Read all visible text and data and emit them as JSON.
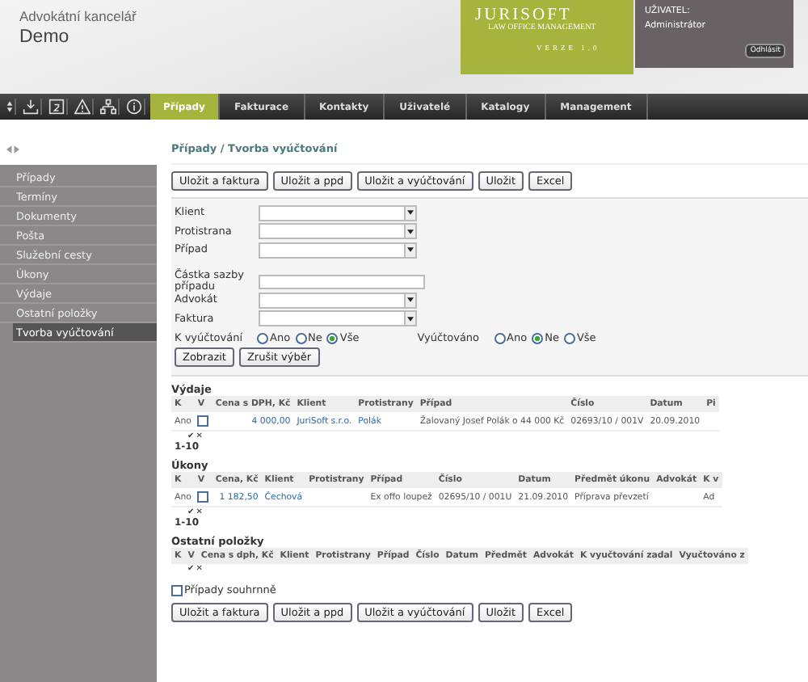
{
  "header": {
    "office_label": "Advokátní kancelář",
    "office_name": "Demo",
    "brand": {
      "name": "JURISOFT",
      "subtitle": "LAW OFFICE MANAGEMENT",
      "version": "VERZE 1.0"
    },
    "user": {
      "label": "UŽIVATEL:",
      "name": "Administrátor",
      "logout": "Odhlásit"
    }
  },
  "tabs": [
    {
      "label": "Případy",
      "selected": true
    },
    {
      "label": "Fakturace",
      "selected": false
    },
    {
      "label": "Kontakty",
      "selected": false
    },
    {
      "label": "Uživatelé",
      "selected": false
    },
    {
      "label": "Katalogy",
      "selected": false
    },
    {
      "label": "Management",
      "selected": false
    }
  ],
  "sidebar": {
    "items": [
      {
        "label": "Případy",
        "selected": false
      },
      {
        "label": "Termíny",
        "selected": false
      },
      {
        "label": "Dokumenty",
        "selected": false
      },
      {
        "label": "Pošta",
        "selected": false
      },
      {
        "label": "Služební cesty",
        "selected": false
      },
      {
        "label": "Úkony",
        "selected": false
      },
      {
        "label": "Výdaje",
        "selected": false
      },
      {
        "label": "Ostatní položky",
        "selected": false
      },
      {
        "label": "Tvorba vyúčtování",
        "selected": true
      }
    ]
  },
  "breadcrumb": "Případy / Tvorba vyúčtování",
  "top_buttons": [
    "Uložit a faktura",
    "Uložit a ppd",
    "Uložit a vyúčtování",
    "Uložit",
    "Excel"
  ],
  "filter": {
    "fields": [
      {
        "kind": "select",
        "label": "Klient"
      },
      {
        "kind": "select",
        "label": "Protistrana"
      },
      {
        "kind": "select",
        "label": "Případ"
      },
      {
        "kind": "gap"
      },
      {
        "kind": "text",
        "label": "Částka sazby případu"
      },
      {
        "kind": "select",
        "label": "Advokát"
      },
      {
        "kind": "select",
        "label": "Faktura"
      }
    ],
    "radio_groups": [
      {
        "label": "K vyúčtování",
        "options": [
          {
            "label": "Ano",
            "selected": false
          },
          {
            "label": "Ne",
            "selected": false
          },
          {
            "label": "Vše",
            "selected": true
          }
        ]
      },
      {
        "label": "Vyúčtováno",
        "options": [
          {
            "label": "Ano",
            "selected": false
          },
          {
            "label": "Ne",
            "selected": true
          },
          {
            "label": "Vše",
            "selected": false
          }
        ]
      }
    ],
    "buttons": [
      "Zobrazit",
      "Zrušit výběr"
    ]
  },
  "sections": [
    {
      "title": "Výdaje",
      "columns": [
        "K",
        "V",
        "Cena s DPH, Kč",
        "Klient",
        "Protistrany",
        "Případ",
        "Číslo",
        "Datum",
        "Pi"
      ],
      "rows": [
        {
          "cells": [
            "Ano",
            "",
            "4 000,00",
            "JuriSoft s.r.o.",
            "Polák",
            "Žalovaný Josef Polák o 44 000 Kč",
            "02693/10 / 001V",
            "20.09.2010",
            ""
          ],
          "checked": false
        }
      ],
      "marks": [
        "✔",
        "✕"
      ],
      "pager": "1-10"
    },
    {
      "title": "Úkony",
      "columns": [
        "K",
        "V",
        "Cena, Kč",
        "Klient",
        "Protistrany",
        "Případ",
        "Číslo",
        "Datum",
        "Předmět úkonu",
        "Advokát",
        "K v"
      ],
      "rows": [
        {
          "cells": [
            "Ano",
            "",
            "1 182,50",
            "Čechová",
            "",
            "Ex offo loupež",
            "02695/10 / 001U",
            "21.09.2010",
            "Příprava převzetí",
            "",
            "Ad"
          ],
          "checked": false
        }
      ],
      "marks": [
        "✔",
        "✕"
      ],
      "pager": "1-10"
    },
    {
      "title": "Ostatní položky",
      "columns": [
        "K",
        "V",
        "Cena s dph, Kč",
        "Klient",
        "Protistrany",
        "Případ",
        "Číslo",
        "Datum",
        "Předmět",
        "Advokát",
        "K vyučtování zadal",
        "Vyučtováno z"
      ],
      "marks": [
        "✔",
        "✕"
      ]
    }
  ],
  "summary_checkbox": {
    "label": "Případy souhrnně",
    "checked": false
  },
  "bottom_buttons": [
    "Uložit a faktura",
    "Uložit a ppd",
    "Uložit a vyúčtování",
    "Uložit",
    "Excel"
  ]
}
